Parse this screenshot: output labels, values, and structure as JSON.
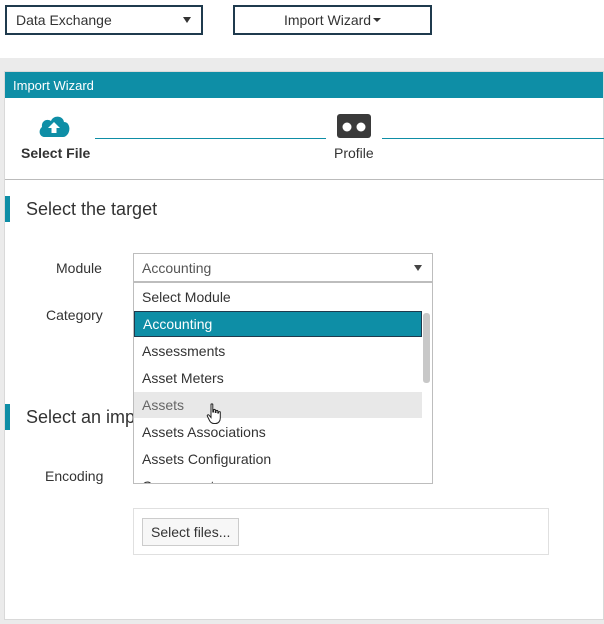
{
  "topbar": {
    "module_dropdown": "Data Exchange",
    "wizard_dropdown": "Import Wizard"
  },
  "panel": {
    "title": "Import Wizard"
  },
  "steps": [
    {
      "label": "Select File",
      "icon": "cloud-upload-icon",
      "active": true
    },
    {
      "label": "Profile",
      "icon": "profile-icon",
      "active": false
    }
  ],
  "sections": {
    "target_title": "Select the target",
    "import_title": "Select an impo"
  },
  "form": {
    "module_label": "Module",
    "module_value": "Accounting",
    "category_label": "Category",
    "encoding_label": "Encoding",
    "select_files_label": "Select files..."
  },
  "dropdown": {
    "items": [
      "Select Module",
      "Accounting",
      "Assessments",
      "Asset Meters",
      "Assets",
      "Assets Associations",
      "Assets Configuration",
      "Components"
    ],
    "selected": "Accounting",
    "hovered": "Assets"
  },
  "colors": {
    "accent": "#0e8ea6",
    "border_dark": "#1f3a4d"
  }
}
